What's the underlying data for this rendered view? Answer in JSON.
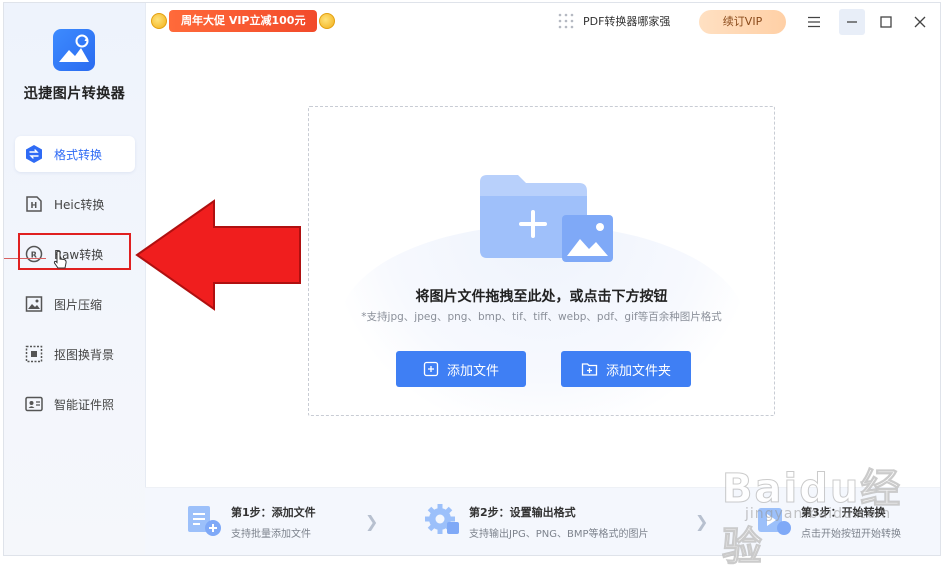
{
  "app": {
    "name": "迅捷图片转换器"
  },
  "sidebar": {
    "items": [
      {
        "label": "格式转换",
        "icon": "swap-icon",
        "active": true
      },
      {
        "label": "Heic转换",
        "icon": "heic-icon"
      },
      {
        "label": "Raw转换",
        "icon": "raw-icon"
      },
      {
        "label": "图片压缩",
        "icon": "image-compress-icon"
      },
      {
        "label": "抠图换背景",
        "icon": "cutout-icon"
      },
      {
        "label": "智能证件照",
        "icon": "id-photo-icon"
      }
    ]
  },
  "header": {
    "promo": "周年大促 VIP立减100元",
    "pdf_link": "PDF转换器哪家强",
    "vip_button": "续订VIP"
  },
  "dropzone": {
    "title": "将图片文件拖拽至此处，或点击下方按钮",
    "subtitle": "*支持jpg、jpeg、png、bmp、tif、tiff、webp、pdf、gif等百余种图片格式",
    "add_file": "添加文件",
    "add_folder": "添加文件夹"
  },
  "steps": [
    {
      "title": "第1步：添加文件",
      "desc": "支持批量添加文件"
    },
    {
      "title": "第2步：设置输出格式",
      "desc": "支持输出JPG、PNG、BMP等格式的图片"
    },
    {
      "title": "第3步：开始转换",
      "desc": "点击开始按钮开始转换"
    }
  ],
  "watermark": {
    "logo": "Baidu经验",
    "url": "jingyan.baidu.com"
  },
  "colors": {
    "accent": "#3f7ff4",
    "annotation_red": "#e02020"
  }
}
